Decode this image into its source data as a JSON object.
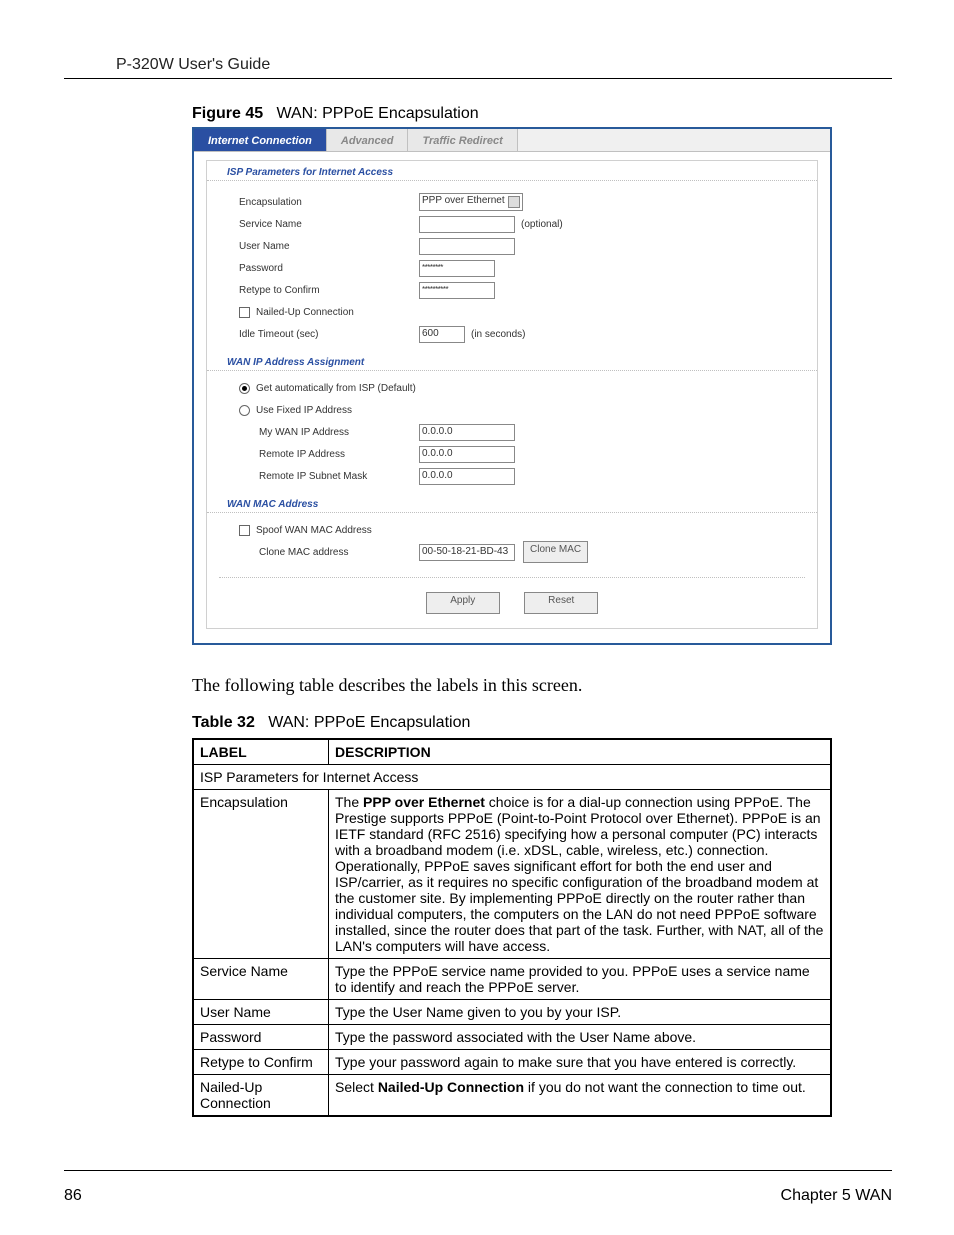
{
  "header": {
    "doc_title": "P-320W User's Guide"
  },
  "figure": {
    "label": "Figure 45",
    "caption": "WAN: PPPoE Encapsulation"
  },
  "tabs": {
    "items": [
      {
        "label": "Internet Connection",
        "active": true
      },
      {
        "label": "Advanced",
        "active": false
      },
      {
        "label": "Traffic Redirect",
        "active": false
      }
    ]
  },
  "sections": {
    "isp_header": "ISP Parameters for Internet Access",
    "wan_ip_header": "WAN IP Address Assignment",
    "wan_mac_header": "WAN MAC Address"
  },
  "fields": {
    "encapsulation_label": "Encapsulation",
    "encapsulation_value": "PPP over Ethernet",
    "service_name_label": "Service Name",
    "service_name_value": "",
    "service_name_note": "(optional)",
    "user_name_label": "User Name",
    "user_name_value": "",
    "password_label": "Password",
    "password_value": "********",
    "retype_label": "Retype to Confirm",
    "retype_value": "**********",
    "nailed_up_label": "Nailed-Up Connection",
    "nailed_up_checked": false,
    "idle_timeout_label": "Idle Timeout (sec)",
    "idle_timeout_value": "600",
    "idle_timeout_note": "(in seconds)",
    "get_auto_label": "Get automatically from ISP (Default)",
    "use_fixed_label": "Use Fixed IP Address",
    "ip_mode_selected": "auto",
    "my_wan_ip_label": "My WAN IP Address",
    "my_wan_ip_value": "0.0.0.0",
    "remote_ip_label": "Remote IP Address",
    "remote_ip_value": "0.0.0.0",
    "remote_subnet_label": "Remote IP Subnet Mask",
    "remote_subnet_value": "0.0.0.0",
    "spoof_mac_label": "Spoof WAN MAC Address",
    "spoof_mac_checked": false,
    "clone_mac_label": "Clone MAC address",
    "clone_mac_value": "00-50-18-21-BD-43",
    "clone_mac_btn": "Clone MAC",
    "apply_btn": "Apply",
    "reset_btn": "Reset"
  },
  "body_text": "The following table describes the labels in this screen.",
  "table_caption": {
    "label": "Table 32",
    "caption": "WAN: PPPoE Encapsulation"
  },
  "table": {
    "head": {
      "label": "LABEL",
      "description": "DESCRIPTION"
    },
    "section_row": "ISP Parameters for Internet Access",
    "rows": [
      {
        "label": "Encapsulation",
        "desc_prefix": "The ",
        "desc_bold": "PPP over Ethernet",
        "desc_rest": " choice is for a dial-up connection using PPPoE. The Prestige supports PPPoE (Point-to-Point Protocol over Ethernet). PPPoE is an IETF standard (RFC 2516) specifying how a personal computer (PC) interacts with a broadband modem (i.e. xDSL, cable, wireless, etc.) connection. Operationally, PPPoE saves significant effort for both the end user and ISP/carrier, as it requires no specific configuration of the broadband modem at the customer site. By implementing PPPoE directly on the router rather than individual computers, the computers on the LAN do not need PPPoE software installed, since the router does that part of the task. Further, with NAT, all of the LAN's computers will have access."
      },
      {
        "label": "Service Name",
        "desc": "Type the PPPoE service name provided to you. PPPoE uses a service name to identify and reach the PPPoE server."
      },
      {
        "label": "User Name",
        "desc": "Type the User Name given to you by your ISP."
      },
      {
        "label": "Password",
        "desc": "Type the password associated with the User Name above."
      },
      {
        "label": "Retype to Confirm",
        "desc": "Type your password again to make sure that you have entered is correctly."
      },
      {
        "label": "Nailed-Up Connection",
        "desc_prefix": "Select ",
        "desc_bold": "Nailed-Up Connection",
        "desc_rest": " if you do not want the connection to time out."
      }
    ]
  },
  "footer": {
    "page": "86",
    "chapter": "Chapter 5 WAN"
  }
}
